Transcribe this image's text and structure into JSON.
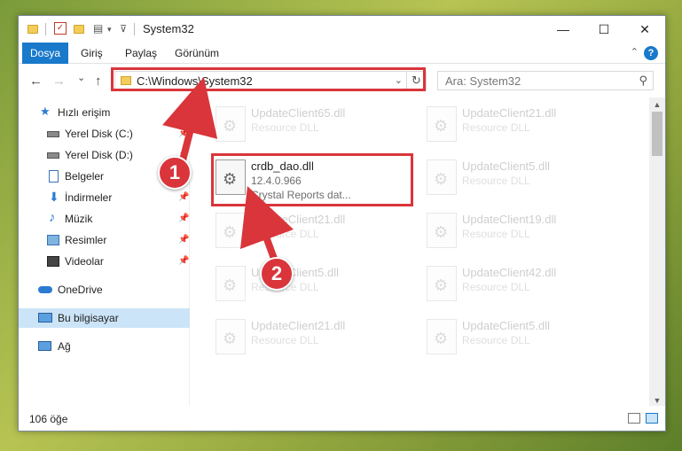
{
  "window": {
    "title": "System32",
    "minimize_label": "—",
    "maximize_label": "☐",
    "close_label": "✕"
  },
  "ribbon": {
    "tabs": [
      {
        "label": "Dosya",
        "active": true
      },
      {
        "label": "Giriş"
      },
      {
        "label": "Paylaş"
      },
      {
        "label": "Görünüm"
      }
    ],
    "help_label": "?"
  },
  "nav": {
    "back_glyph": "←",
    "forward_glyph": "→",
    "recent_glyph": "⌄",
    "up_glyph": "↑",
    "address": "C:\\Windows\\System32",
    "search_placeholder": "Ara: System32"
  },
  "sidebar": {
    "items": [
      {
        "label": "Hızlı erişim",
        "icon": "star-icon"
      },
      {
        "label": "Yerel Disk (C:)",
        "icon": "drive-icon",
        "pinned": true
      },
      {
        "label": "Yerel Disk (D:)",
        "icon": "drive-icon",
        "pinned": true
      },
      {
        "label": "Belgeler",
        "icon": "documents-icon",
        "pinned": true
      },
      {
        "label": "İndirmeler",
        "icon": "download-icon",
        "pinned": true
      },
      {
        "label": "Müzik",
        "icon": "music-icon",
        "pinned": true
      },
      {
        "label": "Resimler",
        "icon": "pictures-icon",
        "pinned": true
      },
      {
        "label": "Videolar",
        "icon": "videos-icon",
        "pinned": true
      },
      {
        "label": "OneDrive",
        "icon": "cloud-icon"
      },
      {
        "label": "Bu bilgisayar",
        "icon": "computer-icon",
        "selected": true
      },
      {
        "label": "Ağ",
        "icon": "network-icon"
      }
    ],
    "pin_glyph": "📌"
  },
  "files": {
    "left": [
      {
        "name": "UpdateClient65.dll",
        "type": "Resource DLL"
      },
      {
        "name": "crdb_dao.dll",
        "version": "12.4.0.966",
        "description": "Crystal Reports dat...",
        "highlighted": true
      },
      {
        "name": "UpdateClient21.dll",
        "type": "Resource DLL"
      },
      {
        "name": "UpdateClient5.dll",
        "type": "Resource DLL"
      },
      {
        "name": "UpdateClient21.dll",
        "type": "Resource DLL"
      }
    ],
    "right": [
      {
        "name": "UpdateClient21.dll",
        "type": "Resource DLL"
      },
      {
        "name": "UpdateClient5.dll",
        "type": "Resource DLL"
      },
      {
        "name": "UpdateClient19.dll",
        "type": "Resource DLL"
      },
      {
        "name": "UpdateClient42.dll",
        "type": "Resource DLL"
      },
      {
        "name": "UpdateClient5.dll",
        "type": "Resource DLL"
      }
    ]
  },
  "status": {
    "count": "106 öğe"
  },
  "annotations": {
    "step1": "1",
    "step2": "2",
    "color": "#d9353a"
  }
}
